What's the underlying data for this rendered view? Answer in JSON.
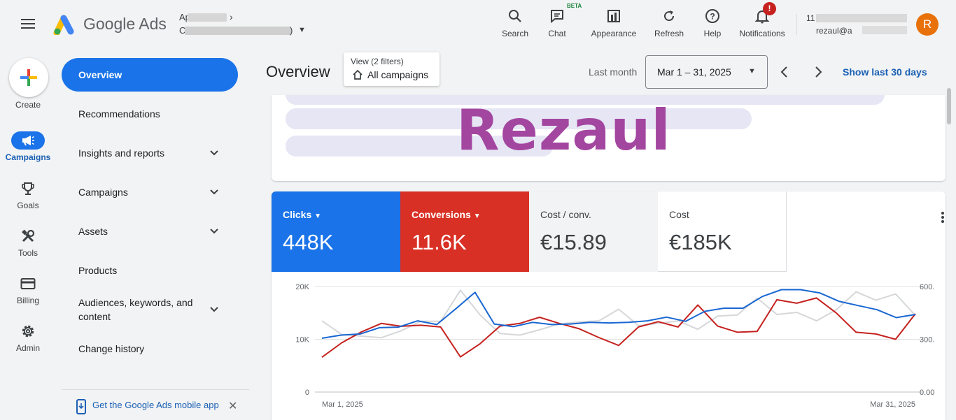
{
  "header": {
    "app_name": "Google Ads",
    "account_line1_prefix": "Ap",
    "account_line2_prefix": "C",
    "account_line2_suffix": ")",
    "tools": [
      {
        "label": "Search",
        "icon": "search-icon"
      },
      {
        "label": "Chat",
        "icon": "chat-icon"
      },
      {
        "label": "Appearance",
        "icon": "appearance-icon"
      },
      {
        "label": "Refresh",
        "icon": "refresh-icon"
      },
      {
        "label": "Help",
        "icon": "help-icon"
      },
      {
        "label": "Notifications",
        "icon": "bell-icon"
      }
    ],
    "chat_badge": "BETA",
    "notification_badge": "!",
    "user_line1_prefix": "11",
    "user_line2": "rezaul@a",
    "avatar_letter": "R"
  },
  "rail": {
    "create_label": "Create",
    "items": [
      {
        "label": "Campaigns",
        "icon": "megaphone-icon",
        "active": true
      },
      {
        "label": "Goals",
        "icon": "trophy-icon"
      },
      {
        "label": "Tools",
        "icon": "tools-icon"
      },
      {
        "label": "Billing",
        "icon": "credit-card-icon"
      },
      {
        "label": "Admin",
        "icon": "gear-icon"
      }
    ]
  },
  "nav": {
    "overview": "Overview",
    "items": [
      {
        "label": "Recommendations"
      },
      {
        "label": "Insights and reports",
        "expandable": true
      },
      {
        "label": "Campaigns",
        "expandable": true
      },
      {
        "label": "Assets",
        "expandable": true
      },
      {
        "label": "Products"
      },
      {
        "label": "Audiences, keywords, and content",
        "expandable": true
      },
      {
        "label": "Change history"
      }
    ],
    "mobile_app_link": "Get the Google Ads mobile app"
  },
  "main": {
    "title": "Overview",
    "view_filter_small": "View (2 filters)",
    "view_filter_main": "All campaigns",
    "period_label": "Last month",
    "date_range": "Mar 1 – 31, 2025",
    "show_last_30": "Show last 30 days"
  },
  "watermark": "Rezaul",
  "metrics": [
    {
      "label": "Clicks",
      "value": "448K",
      "dropdown": true,
      "color": "#1a73e8"
    },
    {
      "label": "Conversions",
      "value": "11.6K",
      "dropdown": true,
      "color": "#d93025"
    },
    {
      "label": "Cost / conv.",
      "value": "€15.89"
    },
    {
      "label": "Cost",
      "value": "€185K"
    }
  ],
  "chart_data": {
    "type": "line",
    "x_start_label": "Mar 1, 2025",
    "x_end_label": "Mar 31, 2025",
    "y_left_ticks": [
      "20K",
      "10K",
      "0"
    ],
    "y_left_max": 20000,
    "y_right_ticks": [
      "600.",
      "300.",
      "0.00"
    ],
    "y_right_max": 600,
    "grid": true,
    "series": [
      {
        "axis": "left",
        "color": "#1967d2",
        "values": [
          10200,
          10800,
          11000,
          12200,
          12300,
          13500,
          12800,
          15800,
          18900,
          12900,
          12400,
          13200,
          12800,
          12900,
          13200,
          13100,
          13200,
          13500,
          14200,
          13400,
          15300,
          15900,
          15900,
          18100,
          19400,
          19400,
          18800,
          17200,
          16400,
          15600,
          14100,
          14700
        ]
      },
      {
        "axis": "right",
        "color": "#c5221f",
        "values": [
          198,
          280,
          342,
          390,
          374,
          380,
          370,
          200,
          275,
          375,
          390,
          425,
          390,
          360,
          310,
          265,
          370,
          400,
          370,
          495,
          375,
          340,
          345,
          525,
          505,
          535,
          450,
          340,
          330,
          300,
          445
        ]
      },
      {
        "axis": "left",
        "color": "#d5d7d9",
        "values": [
          13500,
          10900,
          10600,
          10300,
          11600,
          13400,
          13400,
          19300,
          14600,
          11100,
          10800,
          11800,
          12900,
          13300,
          13500,
          15700,
          12600,
          13000,
          13500,
          11900,
          14400,
          14600,
          17800,
          14700,
          15100,
          13500,
          15600,
          19000,
          17400,
          18600,
          14500
        ]
      }
    ]
  }
}
